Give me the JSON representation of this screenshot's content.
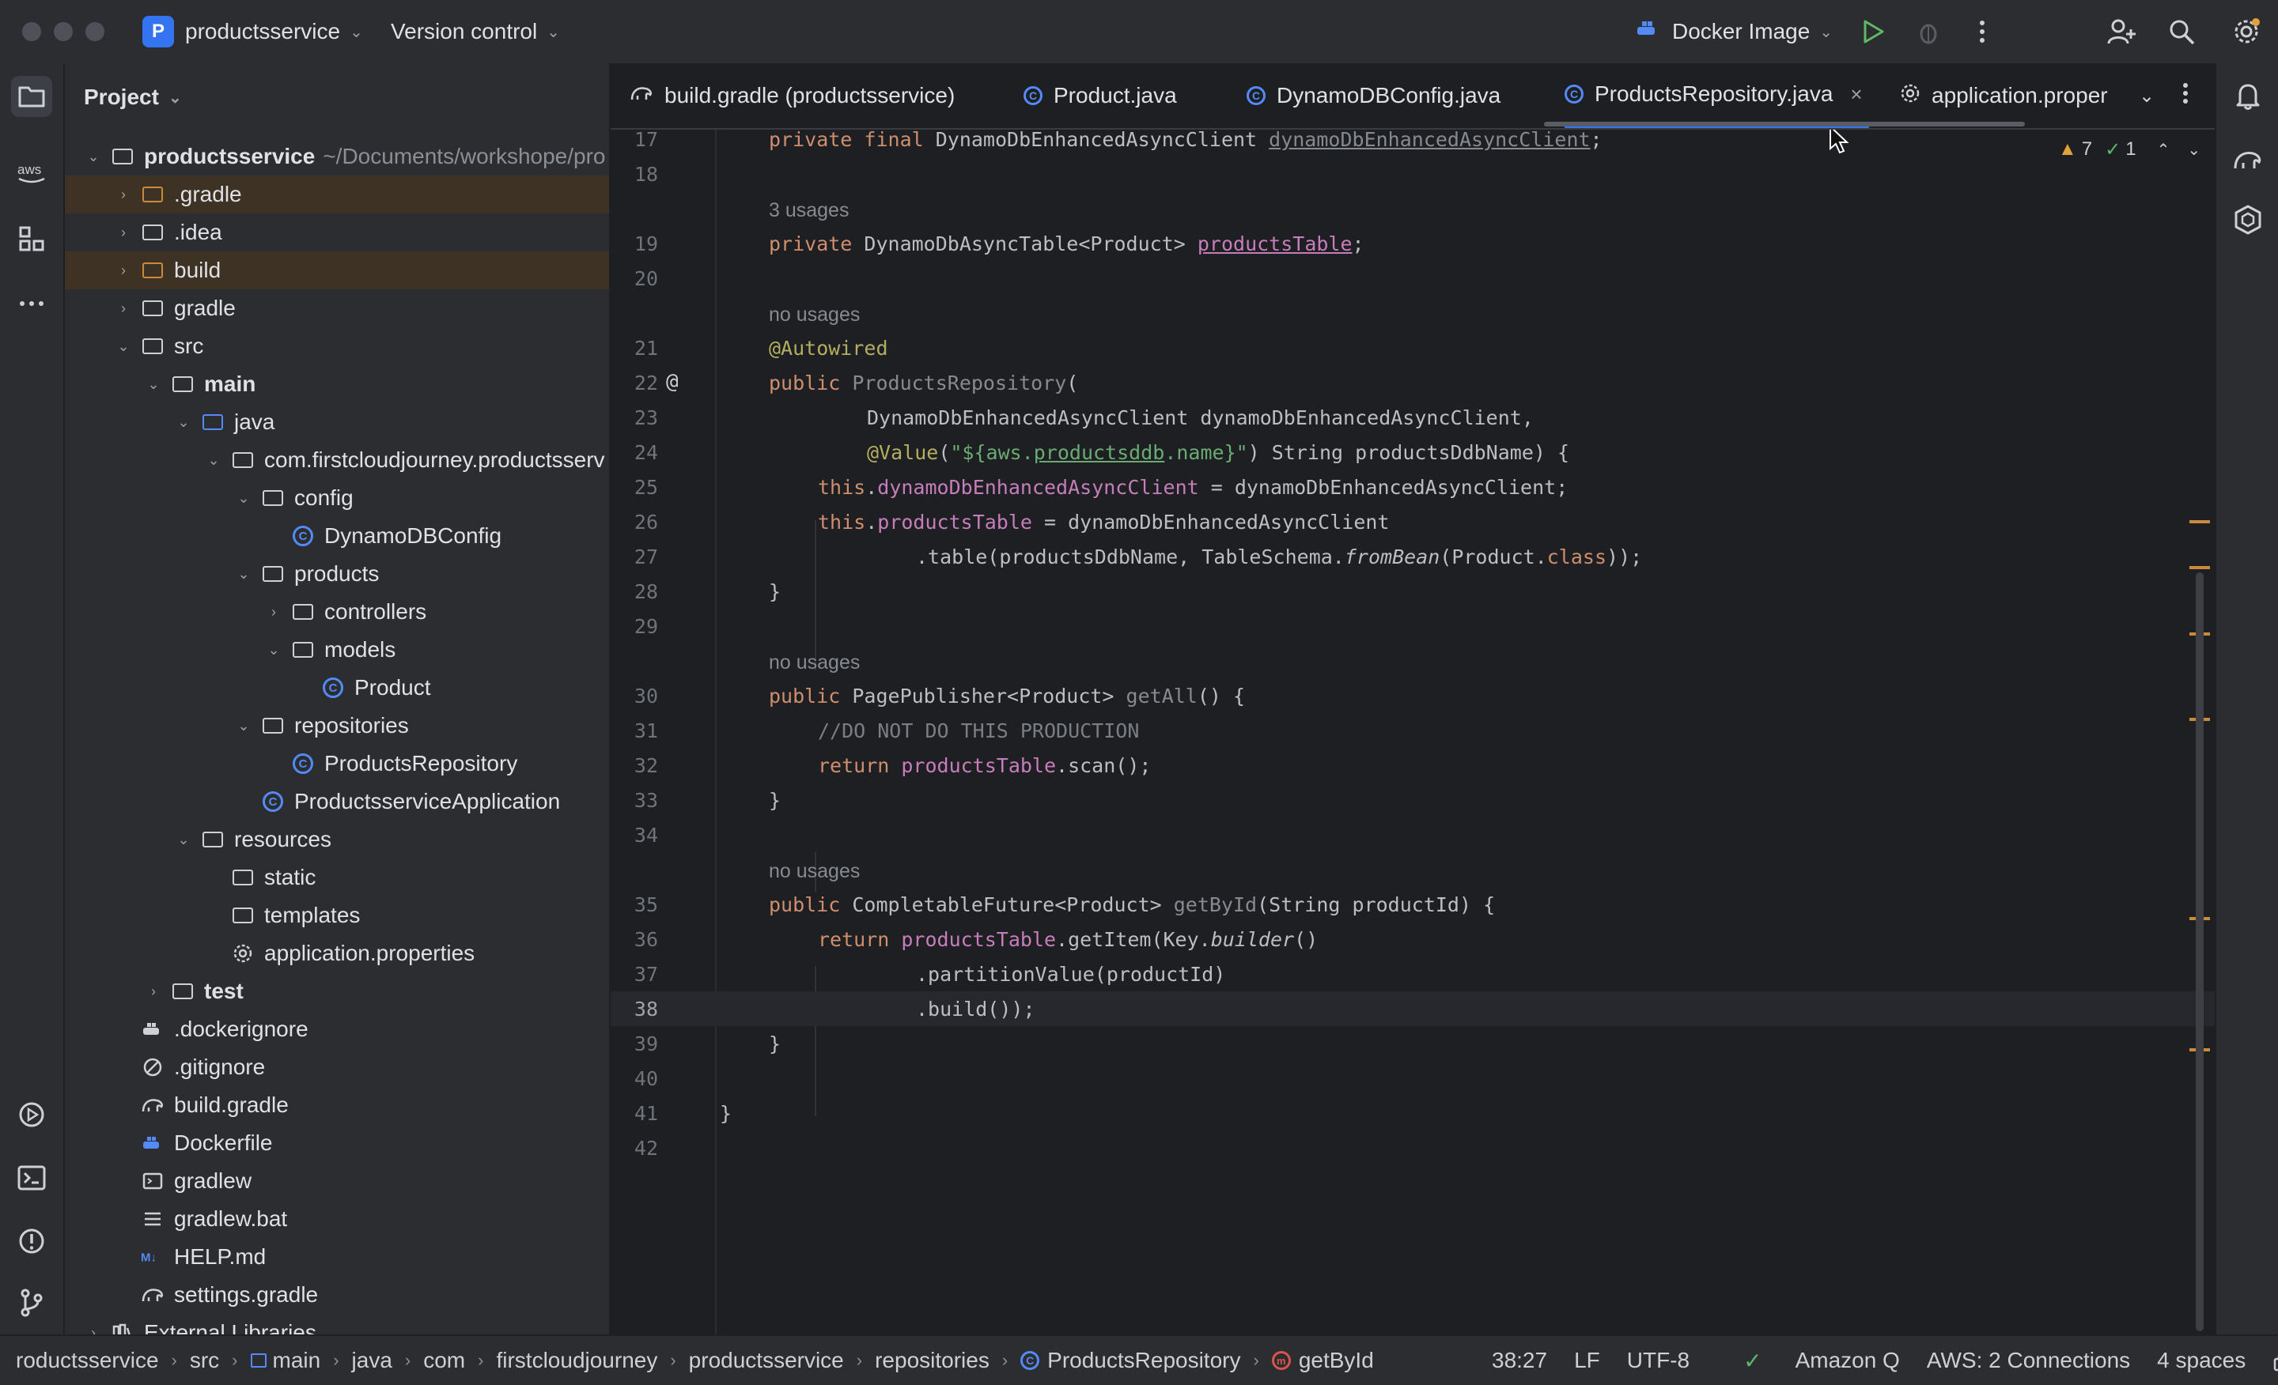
{
  "titlebar": {
    "project_badge": "P",
    "project_name": "productsservice",
    "vcs_label": "Version control",
    "run_config": "Docker Image"
  },
  "project_panel": {
    "title": "Project",
    "tree": [
      {
        "label": "productsservice",
        "suffix": "~/Documents/workshope/pro"
      },
      {
        "label": ".gradle"
      },
      {
        "label": ".idea"
      },
      {
        "label": "build"
      },
      {
        "label": "gradle"
      },
      {
        "label": "src"
      },
      {
        "label": "main"
      },
      {
        "label": "java"
      },
      {
        "label": "com.firstcloudjourney.productsserv"
      },
      {
        "label": "config"
      },
      {
        "label": "DynamoDBConfig"
      },
      {
        "label": "products"
      },
      {
        "label": "controllers"
      },
      {
        "label": "models"
      },
      {
        "label": "Product"
      },
      {
        "label": "repositories"
      },
      {
        "label": "ProductsRepository"
      },
      {
        "label": "ProductsserviceApplication"
      },
      {
        "label": "resources"
      },
      {
        "label": "static"
      },
      {
        "label": "templates"
      },
      {
        "label": "application.properties"
      },
      {
        "label": "test"
      },
      {
        "label": ".dockerignore"
      },
      {
        "label": ".gitignore"
      },
      {
        "label": "build.gradle"
      },
      {
        "label": "Dockerfile"
      },
      {
        "label": "gradlew"
      },
      {
        "label": "gradlew.bat"
      },
      {
        "label": "HELP.md"
      },
      {
        "label": "settings.gradle"
      },
      {
        "label": "External Libraries"
      }
    ]
  },
  "tabs": [
    {
      "label": "build.gradle (productsservice)"
    },
    {
      "label": "Product.java"
    },
    {
      "label": "DynamoDBConfig.java"
    },
    {
      "label": "ProductsRepository.java",
      "active": true
    },
    {
      "label": "application.proper"
    }
  ],
  "inspections": {
    "warnings": "7",
    "ok": "1"
  },
  "editor": {
    "line_numbers": [
      "17",
      "18",
      "19",
      "20",
      "21",
      "22",
      "23",
      "24",
      "25",
      "26",
      "27",
      "28",
      "29",
      "30",
      "31",
      "32",
      "33",
      "34",
      "35",
      "36",
      "37",
      "38",
      "39",
      "40",
      "41",
      "42"
    ],
    "hints": {
      "h19": "3 usages",
      "h21": "no usages",
      "h30": "no usages",
      "h35": "no usages"
    },
    "tokens": {
      "l17": [
        "private final ",
        "DynamoDbEnhancedAsyncClient ",
        "dynamoDbEnhancedAsyncClient",
        ";"
      ],
      "l19": [
        "private ",
        "DynamoDbAsyncTable<Product> ",
        "productsTable",
        ";"
      ],
      "l21": [
        "@Autowired"
      ],
      "l22": [
        "public ",
        "ProductsRepository",
        "("
      ],
      "l23": [
        "DynamoDbEnhancedAsyncClient dynamoDbEnhancedAsyncClient,"
      ],
      "l24": [
        "@Value",
        "(",
        "\"${aws.",
        "productsddb",
        ".name}\"",
        ") String productsDdbName) {"
      ],
      "l25": [
        "this",
        ".",
        "dynamoDbEnhancedAsyncClient",
        " = dynamoDbEnhancedAsyncClient;"
      ],
      "l26": [
        "this",
        ".",
        "productsTable",
        " = dynamoDbEnhancedAsyncClient"
      ],
      "l27": [
        ".table(productsDdbName, TableSchema.",
        "fromBean",
        "(Product.",
        "class",
        "));"
      ],
      "l28": [
        "}"
      ],
      "l30": [
        "public ",
        "PagePublisher<Product> ",
        "getAll",
        "() {"
      ],
      "l31": [
        "//DO NOT DO THIS PRODUCTION"
      ],
      "l32": [
        "return ",
        "productsTable",
        ".scan();"
      ],
      "l33": [
        "}"
      ],
      "l35": [
        "public ",
        "CompletableFuture<Product> ",
        "getById",
        "(String productId) {"
      ],
      "l36": [
        "return ",
        "productsTable",
        ".getItem(Key.",
        "builder",
        "()"
      ],
      "l37": [
        ".partitionValue(productId)"
      ],
      "l38": [
        ".build());"
      ],
      "l39": [
        "}"
      ],
      "l41": [
        "}"
      ]
    },
    "gutter_marker": "@"
  },
  "statusbar": {
    "breadcrumbs": [
      "roductsservice",
      "src",
      "main",
      "java",
      "com",
      "firstcloudjourney",
      "productsservice",
      "repositories",
      "ProductsRepository",
      "getById"
    ],
    "caret": "38:27",
    "line_sep": "LF",
    "encoding": "UTF-8",
    "amazon_q": "Amazon Q",
    "aws": "AWS: 2 Connections",
    "indent": "4 spaces"
  },
  "colors": {
    "accent": "#3574f0",
    "keyword": "#cf8e6d",
    "field": "#c77dbb",
    "annotation": "#b3ae60",
    "string": "#6aab73",
    "method": "#56a8f5",
    "warning": "#e0a33b"
  }
}
